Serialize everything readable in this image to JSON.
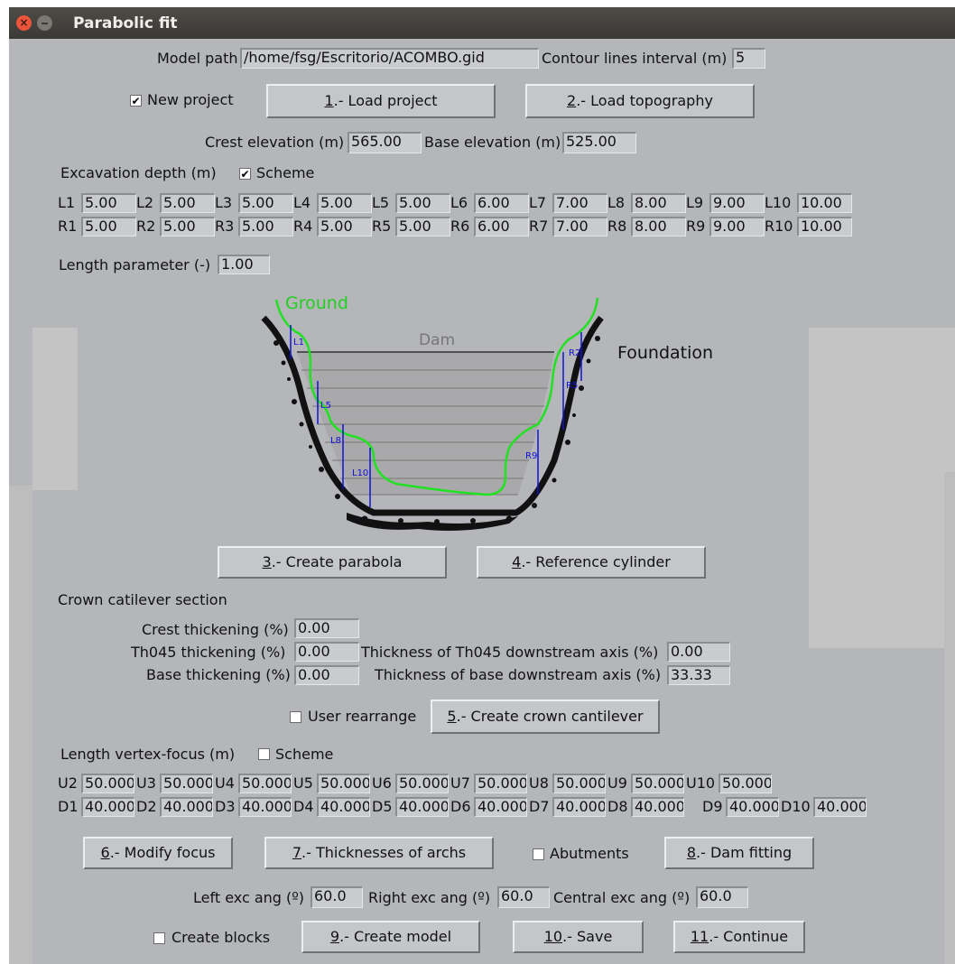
{
  "window": {
    "title": "Parabolic fit"
  },
  "model": {
    "path_label": "Model path",
    "path_value": "/home/fsg/Escritorio/ACOMBO.gid",
    "contour_label": "Contour lines interval (m)",
    "contour_value": "5"
  },
  "project": {
    "new_project_label": "New project",
    "new_project_checked": true,
    "load_project": {
      "mn": "1",
      "rest": ".- Load project"
    },
    "load_topography": {
      "mn": "2",
      "rest": ".- Load topography"
    }
  },
  "elevation": {
    "crest_label": "Crest elevation (m)",
    "crest_value": "565.00",
    "base_label": "Base elevation (m)",
    "base_value": "525.00"
  },
  "excavation": {
    "label": "Excavation depth (m)",
    "scheme_label": "Scheme",
    "scheme_checked": true,
    "left": [
      {
        "label": "L1",
        "value": "5.00"
      },
      {
        "label": "L2",
        "value": "5.00"
      },
      {
        "label": "L3",
        "value": "5.00"
      },
      {
        "label": "L4",
        "value": "5.00"
      },
      {
        "label": "L5",
        "value": "5.00"
      },
      {
        "label": "L6",
        "value": "6.00"
      },
      {
        "label": "L7",
        "value": "7.00"
      },
      {
        "label": "L8",
        "value": "8.00"
      },
      {
        "label": "L9",
        "value": "9.00"
      },
      {
        "label": "L10",
        "value": "10.00"
      }
    ],
    "right": [
      {
        "label": "R1",
        "value": "5.00"
      },
      {
        "label": "R2",
        "value": "5.00"
      },
      {
        "label": "R3",
        "value": "5.00"
      },
      {
        "label": "R4",
        "value": "5.00"
      },
      {
        "label": "R5",
        "value": "5.00"
      },
      {
        "label": "R6",
        "value": "6.00"
      },
      {
        "label": "R7",
        "value": "7.00"
      },
      {
        "label": "R8",
        "value": "8.00"
      },
      {
        "label": "R9",
        "value": "9.00"
      },
      {
        "label": "R10",
        "value": "10.00"
      }
    ]
  },
  "length_param": {
    "label": "Length parameter (-)",
    "value": "1.00"
  },
  "diagram": {
    "ground": "Ground",
    "dam": "Dam",
    "foundation": "Foundation",
    "marks": [
      "L1",
      "L5",
      "L8",
      "L10",
      "R2",
      "R5",
      "R9"
    ]
  },
  "step3": {
    "mn": "3",
    "rest": ".- Create parabola"
  },
  "step4": {
    "mn": "4",
    "rest": ".- Reference cylinder"
  },
  "crown": {
    "section_label": "Crown catilever section",
    "crest_label": "Crest thickening (%)",
    "crest_value": "0.00",
    "th045_label": "Th045 thickening (%)",
    "th045_value": "0.00",
    "th045_axis_label": "Thickness of Th045 downstream axis (%)",
    "th045_axis_value": "0.00",
    "base_label": "Base thickening (%)",
    "base_value": "0.00",
    "base_axis_label": "Thickness of base downstream axis (%)",
    "base_axis_value": "33.33"
  },
  "rearrange": {
    "label": "User rearrange",
    "checked": false
  },
  "step5": {
    "mn": "5",
    "rest": ".- Create crown cantilever"
  },
  "vertex": {
    "label": "Length vertex-focus (m)",
    "scheme_label": "Scheme",
    "scheme_checked": false,
    "up": [
      {
        "label": "U2",
        "value": "50.000"
      },
      {
        "label": "U3",
        "value": "50.000"
      },
      {
        "label": "U4",
        "value": "50.000"
      },
      {
        "label": "U5",
        "value": "50.000"
      },
      {
        "label": "U6",
        "value": "50.000"
      },
      {
        "label": "U7",
        "value": "50.000"
      },
      {
        "label": "U8",
        "value": "50.000"
      },
      {
        "label": "U9",
        "value": "50.000"
      },
      {
        "label": "U10",
        "value": "50.000"
      }
    ],
    "down": [
      {
        "label": "D1",
        "value": "40.000"
      },
      {
        "label": "D2",
        "value": "40.000"
      },
      {
        "label": "D3",
        "value": "40.000"
      },
      {
        "label": "D4",
        "value": "40.000"
      },
      {
        "label": "D5",
        "value": "40.000"
      },
      {
        "label": "D6",
        "value": "40.000"
      },
      {
        "label": "D7",
        "value": "40.000"
      },
      {
        "label": "D8",
        "value": "40.000"
      },
      {
        "label": "D9",
        "value": "40.000"
      },
      {
        "label": "D10",
        "value": "40.000"
      }
    ]
  },
  "step6": {
    "mn": "6",
    "rest": ".- Modify focus"
  },
  "step7": {
    "mn": "7",
    "rest": ".- Thicknesses of archs"
  },
  "abutments": {
    "label": "Abutments",
    "checked": false
  },
  "step8": {
    "mn": "8",
    "rest": ".- Dam fitting"
  },
  "angles": {
    "left_label": "Left exc ang (º)",
    "left_value": "60.0",
    "right_label": "Right exc ang (º)",
    "right_value": "60.0",
    "central_label": "Central exc ang (º)",
    "central_value": "60.0"
  },
  "blocks": {
    "label": "Create blocks",
    "checked": false
  },
  "step9": {
    "mn": "9",
    "rest": ".- Create model"
  },
  "step10": {
    "mn": "10",
    "rest": ".- Save"
  },
  "step11": {
    "mn": "11",
    "rest": ".- Continue"
  }
}
